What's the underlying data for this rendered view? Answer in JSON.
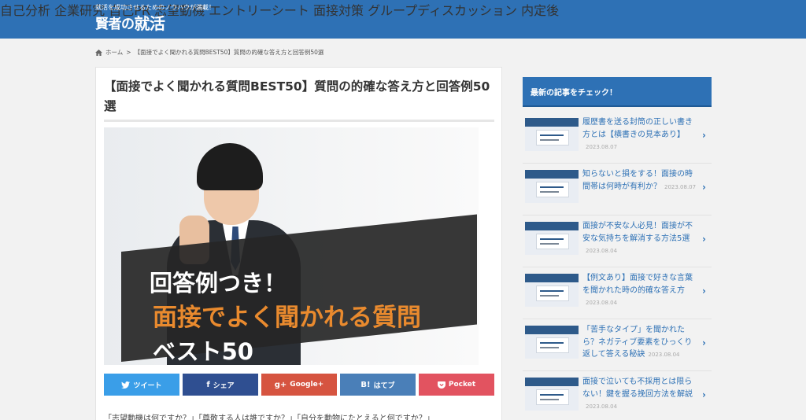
{
  "header": {
    "tagline": "就活を成功させるためのノウハウが満載！",
    "logo_text_1": "賢者の",
    "logo_text_2": "就活",
    "nav": [
      "自己分析",
      "企業研究",
      "自己PR",
      "志望動機",
      "エントリーシート",
      "面接対策",
      "グループディスカッション",
      "内定後"
    ]
  },
  "breadcrumb": {
    "home": "ホーム",
    "separator": ">",
    "current": "【面接でよく聞かれる質問BEST50】質問の的確な答え方と回答例50選"
  },
  "article": {
    "title": "【面接でよく聞かれる質問BEST50】質問の的確な答え方と回答例50選",
    "hero": {
      "line1": "回答例つき！",
      "line2": "面接でよく聞かれる質問",
      "line3": "ベスト50"
    },
    "share_buttons": [
      {
        "label": "ツイート",
        "icon": "twitter-icon",
        "color": "#3a9ee8"
      },
      {
        "label": "シェア",
        "icon": "facebook-icon",
        "color": "#2f4f91"
      },
      {
        "label": "Google+",
        "icon": "google-plus-icon",
        "color": "#d65440"
      },
      {
        "label": "はてブ",
        "icon": "hatena-icon",
        "color": "#4a7fb8"
      },
      {
        "label": "Pocket",
        "icon": "pocket-icon",
        "color": "#e25360"
      }
    ],
    "intro": "「志望動機は何ですか？」「尊敬する人は誰ですか？」「自分を動物にたとえると何ですか？」"
  },
  "sidebar": {
    "heading": "最新の記事をチェック！",
    "items": [
      {
        "title": "履歴書を送る封筒の正しい書き方とは【横書きの見本あり】",
        "date": "2023.08.07"
      },
      {
        "title": "知らないと損をする！面接の時間帯は何時が有利か？",
        "date": "2023.08.07"
      },
      {
        "title": "面接が不安な人必見！面接が不安な気持ちを解消する方法5選",
        "date": "2023.08.04"
      },
      {
        "title": "【例文あり】面接で好きな言葉を聞かれた時の的確な答え方",
        "date": "2023.08.04"
      },
      {
        "title": "「苦手なタイプ」を聞かれたら？ネガティブ要素をひっくり返して答える秘訣",
        "date": "2023.08.04"
      },
      {
        "title": "面接で泣いても不採用とは限らない！鍵を握る挽回方法を解説",
        "date": "2023.08.04"
      }
    ]
  },
  "colors": {
    "brand": "#2e71b5",
    "accent_orange": "#e98a2e"
  }
}
